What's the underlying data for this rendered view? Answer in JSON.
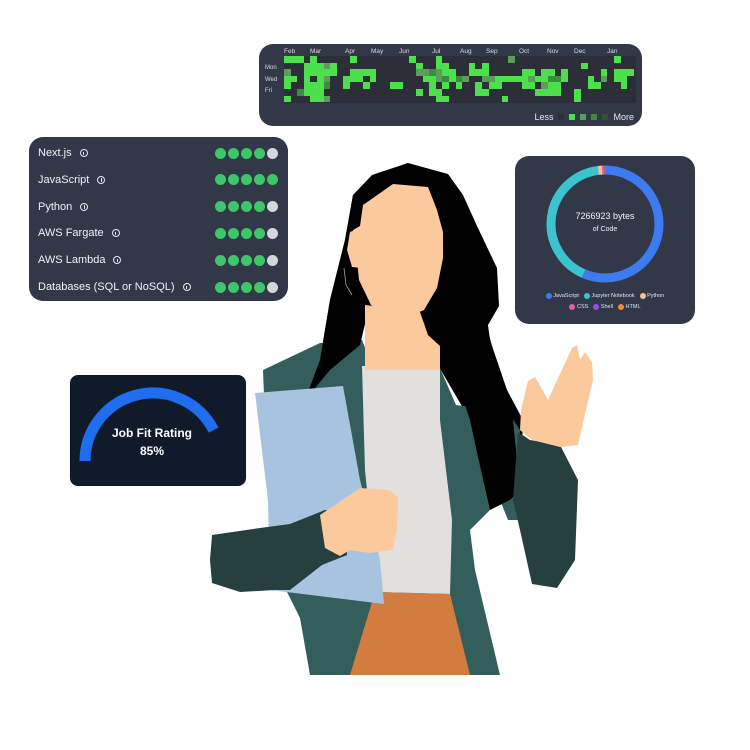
{
  "colors": {
    "card_bg": "#323848",
    "fit_card_bg": "#111a2b",
    "skill_dot_on": "#3fc66a",
    "skill_dot_off": "#d4d6dc",
    "gauge": "#1f6ef0",
    "gauge_track": "#111a2b",
    "skin": "#fbc99c",
    "hair": "#000000",
    "jacket": "#345e5c",
    "sleeve_dark": "#263f3f",
    "shirt": "#e2e0de",
    "folder": "#a7c3df",
    "skirt": "#d27c40"
  },
  "heatmap": {
    "months": [
      "Feb",
      "Mar",
      "Apr",
      "May",
      "Jun",
      "Jul",
      "Aug",
      "Sep",
      "Oct",
      "Nov",
      "Dec",
      "Jan"
    ],
    "days": [
      "Mon",
      "Wed",
      "Fri"
    ],
    "legend_less": "Less",
    "legend_more": "More",
    "level_colors": [
      "#2c2f37",
      "#4ce04c",
      "#5a9e5a",
      "#3e8a3e",
      "#2a5a2a"
    ],
    "weeks": [
      [
        1,
        0,
        2,
        1,
        1,
        0,
        1
      ],
      [
        1,
        0,
        0,
        1,
        0,
        0,
        0
      ],
      [
        1,
        0,
        0,
        0,
        0,
        3,
        0
      ],
      [
        0,
        1,
        1,
        1,
        1,
        1,
        0
      ],
      [
        1,
        1,
        1,
        0,
        1,
        1,
        1
      ],
      [
        0,
        1,
        1,
        1,
        1,
        1,
        1
      ],
      [
        0,
        2,
        1,
        2,
        3,
        0,
        2
      ],
      [
        0,
        1,
        1,
        0,
        0,
        0,
        0
      ],
      [
        0,
        0,
        0,
        0,
        0,
        0,
        0
      ],
      [
        0,
        0,
        0,
        1,
        1,
        0,
        0
      ],
      [
        1,
        0,
        1,
        1,
        0,
        0,
        0
      ],
      [
        0,
        0,
        1,
        1,
        0,
        0,
        0
      ],
      [
        0,
        0,
        1,
        0,
        1,
        0,
        0
      ],
      [
        0,
        0,
        1,
        1,
        0,
        0,
        0
      ],
      [
        0,
        0,
        0,
        0,
        0,
        0,
        0
      ],
      [
        0,
        0,
        0,
        0,
        0,
        0,
        0
      ],
      [
        0,
        0,
        0,
        0,
        1,
        0,
        0
      ],
      [
        0,
        0,
        0,
        0,
        1,
        0,
        0
      ],
      [
        0,
        0,
        0,
        0,
        0,
        0,
        0
      ],
      [
        1,
        0,
        0,
        0,
        0,
        0,
        0
      ],
      [
        0,
        1,
        2,
        0,
        0,
        1,
        0
      ],
      [
        0,
        0,
        2,
        1,
        0,
        0,
        0
      ],
      [
        0,
        0,
        3,
        1,
        1,
        1,
        0
      ],
      [
        1,
        1,
        2,
        2,
        0,
        1,
        1
      ],
      [
        0,
        1,
        1,
        3,
        1,
        0,
        1
      ],
      [
        0,
        0,
        1,
        1,
        0,
        0,
        0
      ],
      [
        0,
        0,
        0,
        3,
        1,
        0,
        0
      ],
      [
        0,
        0,
        0,
        2,
        0,
        0,
        0
      ],
      [
        0,
        1,
        1,
        0,
        0,
        0,
        0
      ],
      [
        0,
        0,
        1,
        0,
        1,
        1,
        0
      ],
      [
        0,
        1,
        1,
        2,
        0,
        1,
        0
      ],
      [
        0,
        0,
        0,
        2,
        1,
        0,
        0
      ],
      [
        0,
        0,
        0,
        1,
        1,
        0,
        0
      ],
      [
        0,
        0,
        0,
        1,
        0,
        0,
        1
      ],
      [
        2,
        0,
        0,
        1,
        0,
        0,
        0
      ],
      [
        0,
        0,
        0,
        1,
        0,
        0,
        0
      ],
      [
        0,
        0,
        1,
        1,
        1,
        0,
        0
      ],
      [
        0,
        0,
        1,
        2,
        1,
        0,
        0
      ],
      [
        0,
        0,
        0,
        1,
        0,
        1,
        0
      ],
      [
        0,
        0,
        1,
        1,
        2,
        1,
        0
      ],
      [
        0,
        0,
        1,
        3,
        1,
        1,
        0
      ],
      [
        0,
        0,
        0,
        3,
        1,
        1,
        0
      ],
      [
        0,
        0,
        1,
        1,
        0,
        0,
        0
      ],
      [
        0,
        0,
        0,
        0,
        0,
        0,
        0
      ],
      [
        0,
        0,
        0,
        0,
        0,
        1,
        1
      ],
      [
        0,
        1,
        0,
        0,
        0,
        0,
        0
      ],
      [
        0,
        0,
        0,
        1,
        1,
        0,
        0
      ],
      [
        0,
        0,
        0,
        0,
        1,
        0,
        0
      ],
      [
        0,
        0,
        1,
        2,
        0,
        0,
        0
      ],
      [
        0,
        0,
        0,
        0,
        0,
        0,
        0
      ],
      [
        1,
        0,
        1,
        1,
        0,
        0,
        0
      ],
      [
        0,
        0,
        1,
        1,
        1,
        0,
        0
      ],
      [
        0,
        0,
        1,
        0,
        0,
        0,
        0
      ]
    ]
  },
  "skills": [
    {
      "name": "Next.js",
      "rating": 4,
      "max": 5
    },
    {
      "name": "JavaScript",
      "rating": 5,
      "max": 5
    },
    {
      "name": "Python",
      "rating": 4,
      "max": 5
    },
    {
      "name": "AWS Fargate",
      "rating": 4,
      "max": 5
    },
    {
      "name": "AWS Lambda",
      "rating": 4,
      "max": 5
    },
    {
      "name": "Databases (SQL or NoSQL)",
      "rating": 4,
      "max": 5
    }
  ],
  "code_bytes": {
    "total_label": "7266923 bytes",
    "sub_label": "of Code",
    "languages": [
      {
        "name": "JavaScript",
        "share": 0.565,
        "color": "#3d7cf0"
      },
      {
        "name": "Jupyter Notebook",
        "share": 0.415,
        "color": "#3bc4d0"
      },
      {
        "name": "Python",
        "share": 0.012,
        "color": "#f0c39a"
      },
      {
        "name": "CSS",
        "share": 0.005,
        "color": "#e45f9e"
      },
      {
        "name": "Shell",
        "share": 0.002,
        "color": "#9a4ee0"
      },
      {
        "name": "HTML",
        "share": 0.001,
        "color": "#f28a3a"
      }
    ]
  },
  "job_fit": {
    "label": "Job Fit Rating",
    "value_label": "85%",
    "value": 0.85
  }
}
